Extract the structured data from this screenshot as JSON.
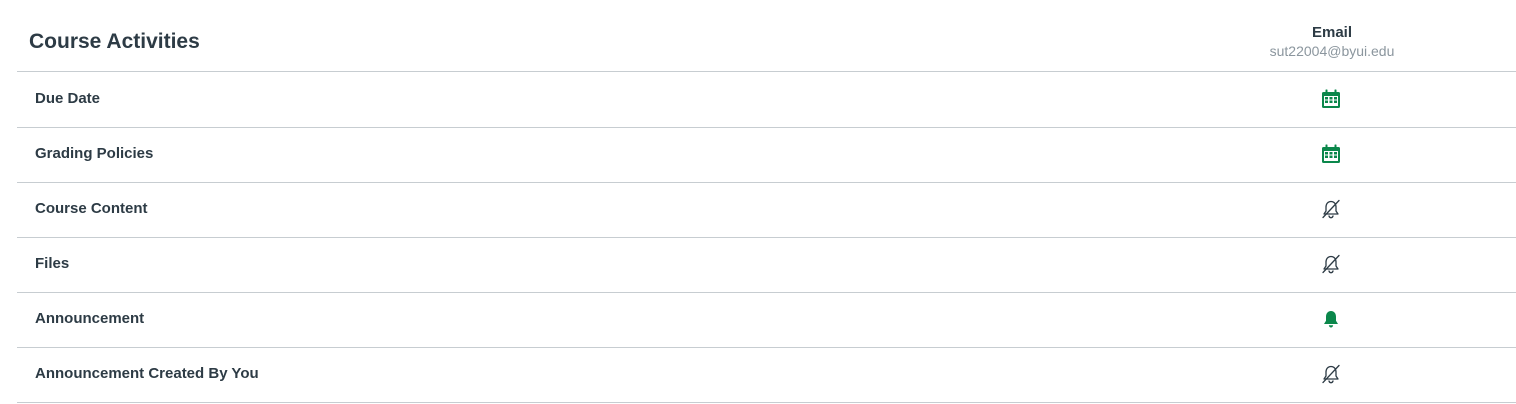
{
  "header": {
    "title": "Course Activities",
    "channel": {
      "type": "Email",
      "address": "sut22004@byui.edu"
    }
  },
  "rows": [
    {
      "label": "Due Date",
      "frequency_icon": "calendar-icon"
    },
    {
      "label": "Grading Policies",
      "frequency_icon": "calendar-icon"
    },
    {
      "label": "Course Content",
      "frequency_icon": "bell-off-icon"
    },
    {
      "label": "Files",
      "frequency_icon": "bell-off-icon"
    },
    {
      "label": "Announcement",
      "frequency_icon": "bell-filled-icon"
    },
    {
      "label": "Announcement Created By You",
      "frequency_icon": "bell-off-icon"
    }
  ],
  "colors": {
    "text": "#2d3b45",
    "muted": "#8b969e",
    "accent_green": "#0b874b",
    "divider": "#c7cdd1",
    "icon_gray": "#2d3b45"
  }
}
